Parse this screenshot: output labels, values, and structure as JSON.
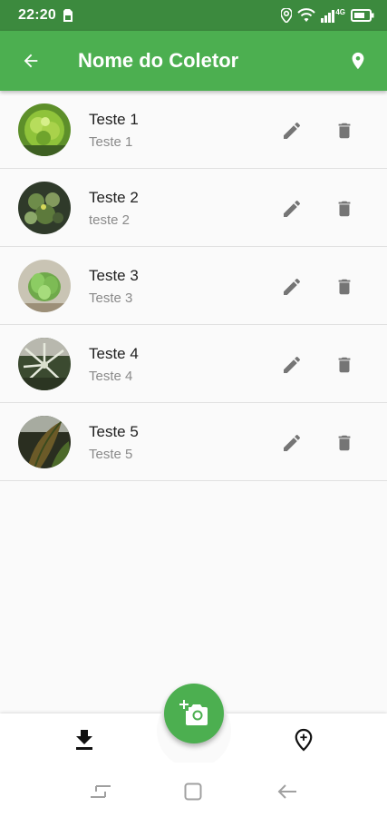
{
  "status_bar": {
    "time": "22:20",
    "network": "4G"
  },
  "app_bar": {
    "title": "Nome do Coletor"
  },
  "colors": {
    "primary": "#4caf50",
    "status_bar": "#3c8a3e",
    "icon_gray": "#757575"
  },
  "items": [
    {
      "title": "Teste 1",
      "subtitle": "Teste 1"
    },
    {
      "title": "Teste 2",
      "subtitle": "teste 2"
    },
    {
      "title": "Teste 3",
      "subtitle": "Teste 3"
    },
    {
      "title": "Teste 4",
      "subtitle": "Teste 4"
    },
    {
      "title": "Teste 5",
      "subtitle": "Teste 5"
    }
  ],
  "icons": {
    "back": "arrow-back-icon",
    "location": "location-pin-icon",
    "edit": "pencil-icon",
    "delete": "trash-icon",
    "fab": "add-a-photo-icon",
    "download": "download-icon",
    "add_location": "add-location-icon"
  }
}
